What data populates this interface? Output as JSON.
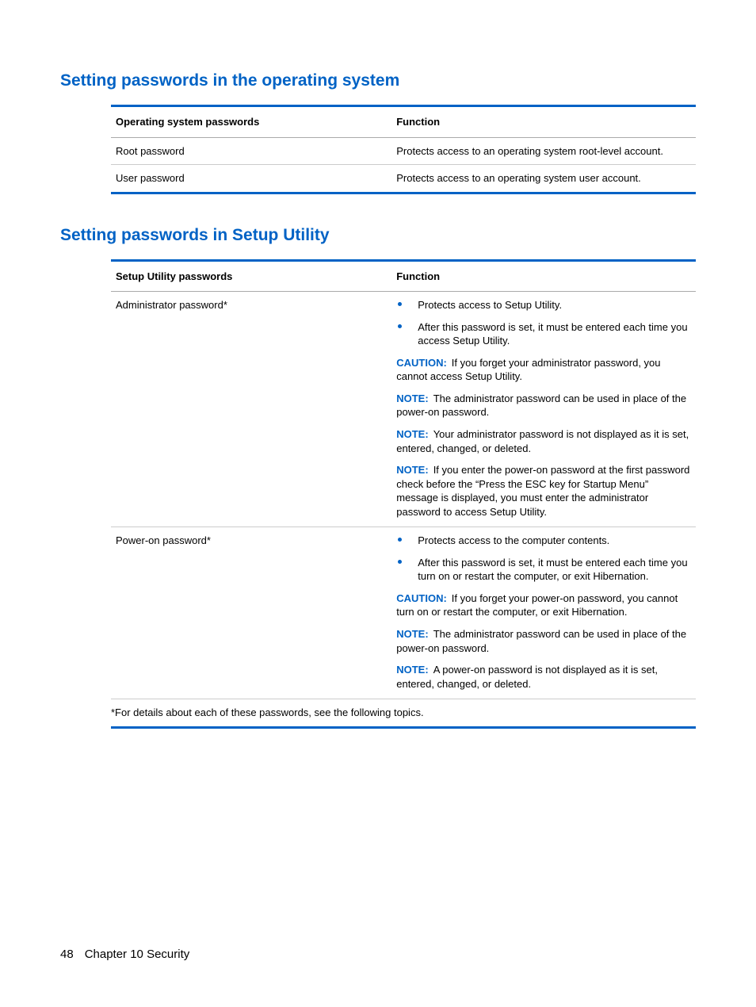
{
  "section1": {
    "heading": "Setting passwords in the operating system",
    "table": {
      "head_l": "Operating system passwords",
      "head_r": "Function",
      "rows": [
        {
          "l": "Root password",
          "r": "Protects access to an operating system root-level account."
        },
        {
          "l": "User password",
          "r": "Protects access to an operating system user account."
        }
      ]
    }
  },
  "section2": {
    "heading": "Setting passwords in Setup Utility",
    "table": {
      "head_l": "Setup Utility passwords",
      "head_r": "Function",
      "rows": [
        {
          "l": "Administrator password*",
          "bullets": [
            "Protects access to Setup Utility.",
            "After this password is set, it must be entered each time you access Setup Utility."
          ],
          "notes": [
            {
              "kw": "CAUTION:",
              "txt": "If you forget your administrator password, you cannot access Setup Utility."
            },
            {
              "kw": "NOTE:",
              "txt": "The administrator password can be used in place of the power-on password."
            },
            {
              "kw": "NOTE:",
              "txt": "Your administrator password is not displayed as it is set, entered, changed, or deleted."
            },
            {
              "kw": "NOTE:",
              "txt": "If you enter the power-on password at the first password check before the “Press the ESC key for Startup Menu” message is displayed, you must enter the administrator password to access Setup Utility."
            }
          ]
        },
        {
          "l": "Power-on password*",
          "bullets": [
            "Protects access to the computer contents.",
            "After this password is set, it must be entered each time you turn on or restart the computer, or exit Hibernation."
          ],
          "notes": [
            {
              "kw": "CAUTION:",
              "txt": "If you forget your power-on password, you cannot turn on or restart the computer, or exit Hibernation."
            },
            {
              "kw": "NOTE:",
              "txt": "The administrator password can be used in place of the power-on password."
            },
            {
              "kw": "NOTE:",
              "txt": "A power-on password is not displayed as it is set, entered, changed, or deleted."
            }
          ]
        }
      ],
      "footnote": "*For details about each of these passwords, see the following topics."
    }
  },
  "footer": {
    "page_number": "48",
    "chapter": "Chapter 10   Security"
  }
}
